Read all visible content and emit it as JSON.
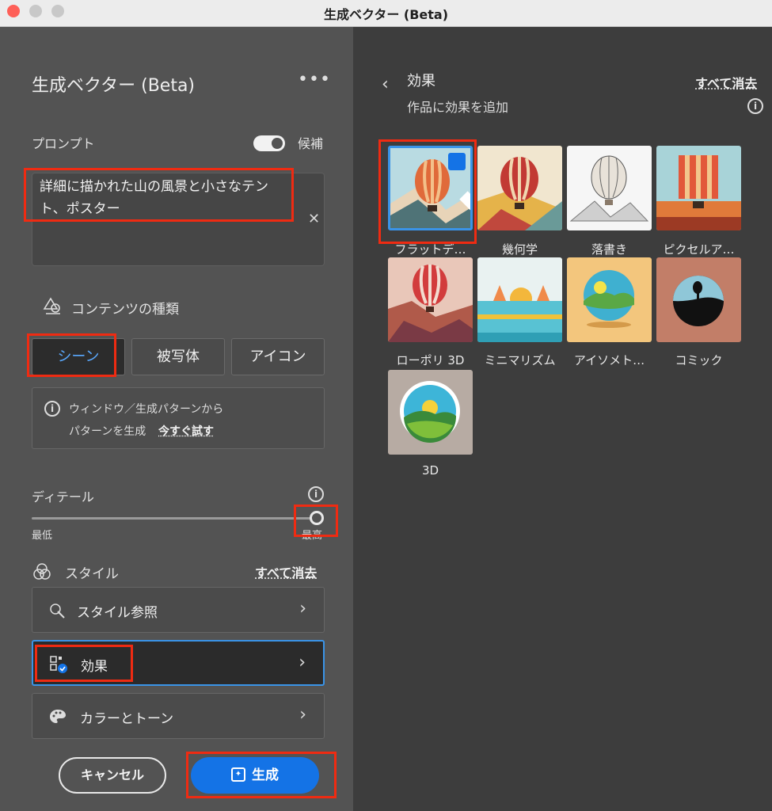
{
  "window": {
    "title": "生成ベクター (Beta)"
  },
  "panel": {
    "title": "生成ベクター (Beta)",
    "more_label": "•••",
    "prompt_label": "プロンプト",
    "suggest_label": "候補",
    "prompt_text": "詳細に描かれた山の風景と小さなテント、ポスター",
    "content_type_label": "コンテンツの種類",
    "content_types": [
      "シーン",
      "被写体",
      "アイコン"
    ],
    "info_line1": "ウィンドウ／生成パターンから",
    "info_line2": "パターンを生成",
    "info_link": "今すぐ試す",
    "detail_label": "ディテール",
    "detail_min": "最低",
    "detail_max": "最高",
    "detail_level": 1.0,
    "style_label": "スタイル",
    "style_clear": "すべて消去",
    "rows": [
      "スタイル参照",
      "効果",
      "カラーとトーン"
    ],
    "cancel": "キャンセル",
    "generate": "生成"
  },
  "effects": {
    "title": "効果",
    "subtitle": "作品に効果を追加",
    "clear": "すべて消去",
    "items": [
      "フラットデ…",
      "幾何学",
      "落書き",
      "ピクセルア…",
      "ローポリ 3D",
      "ミニマリズム",
      "アイソメト…",
      "コミック",
      "3D"
    ],
    "selected": "フラットデ…"
  },
  "colors": {
    "accent": "#1473e6",
    "selection": "#3a94e8",
    "highlight": "#ef2b12"
  }
}
